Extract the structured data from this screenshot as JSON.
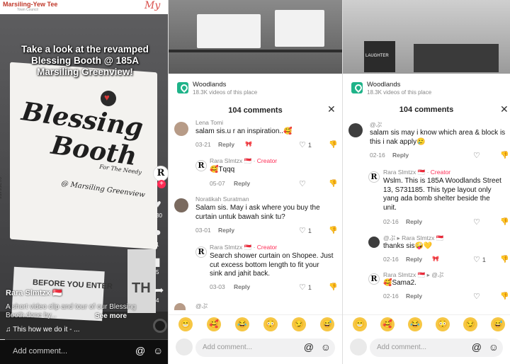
{
  "video": {
    "brand": "Marsiling-Yew Tee",
    "brand_sub": "Town Council",
    "brand_mark": "My",
    "title": "Take a look at the revamped Blessing Booth @ 185A Marsiling Greenview!",
    "sign_line1": "Blessing",
    "sign_line2": "Booth",
    "sign_tagline": "For The Needy",
    "sign_location": "@ Marsiling Greenview",
    "side_number": "91256456",
    "door_text": "BEFORE YOU ENTER",
    "th_text": "TH",
    "author": "Rara Slmtzx 🇸🇬",
    "description": "A short video clip and tour of our Blessing Booth done by...",
    "see_more": "See more",
    "music": "♫ This how we do it  - ...",
    "counts": [
      "30",
      "1",
      "5",
      "4"
    ],
    "progress": 0.03,
    "add_comment": "Add comment...",
    "at_icon": "@",
    "emoji_icon": "☺"
  },
  "comments_left": {
    "location_name": "Woodlands",
    "location_sub": "18.3K videos of this place",
    "title": "104 comments",
    "close": "✕",
    "items": [
      {
        "name": "Lena Tomi",
        "text": "salam sis.u r an inspiration..🥰",
        "date": "03-21",
        "reply": "Reply",
        "likes": "1",
        "flag": "🎀"
      },
      {
        "name": "Rara Slmtzx 🇸🇬 · ",
        "creator": "Creator",
        "text": "🥰Tqqq",
        "date": "05-07",
        "reply": "Reply",
        "likes": ""
      },
      {
        "name": "Noratikah Suratman",
        "text": "Salam sis. May i ask where you buy the curtain untuk bawah sink tu?",
        "date": "03-01",
        "reply": "Reply",
        "likes": "1"
      },
      {
        "name": "Rara Slmtzx 🇸🇬 · ",
        "creator": "Creator",
        "text": "Search shower curtain on Shopee. Just cut excess bottom length to fit your sink and jahit back.",
        "date": "03-03",
        "reply": "Reply",
        "likes": "1"
      },
      {
        "name": "@ぷ"
      }
    ],
    "emojis": [
      "😁",
      "🥰",
      "😂",
      "😳",
      "😏",
      "😅"
    ],
    "placeholder": "Add comment...",
    "at_icon": "@",
    "emoji_icon": "☺"
  },
  "comments_right": {
    "location_name": "Woodlands",
    "location_sub": "18.3K videos of this place",
    "title": "104 comments",
    "close": "✕",
    "items": [
      {
        "name": "@ぷ",
        "text": "salam sis may i know which area & block is this i nak apply🥲",
        "date": "02-16",
        "reply": "Reply",
        "likes": ""
      },
      {
        "name": "Rara Slmtzx 🇸🇬 · ",
        "creator": "Creator",
        "text": "Wslm. This is 185A Woodlands Street 13, S731185. This type layout only yang ada bomb shelter beside the unit.",
        "date": "02-16",
        "reply": "Reply",
        "likes": ""
      },
      {
        "name": "@ぷ ▸ Rara Slmtzx 🇸🇬",
        "text": "thanks sis🤪💛",
        "date": "02-16",
        "reply": "Reply",
        "likes": "1",
        "flag": "🎀"
      },
      {
        "name": "Rara Slmtzx 🇸🇬 ▸ @ぷ",
        "text": "🥰Sama2.",
        "date": "02-16",
        "reply": "Reply",
        "likes": ""
      }
    ],
    "emojis": [
      "😁",
      "🥰",
      "😂",
      "😳",
      "😏",
      "😅"
    ],
    "placeholder": "Add comment...",
    "at_icon": "@",
    "emoji_icon": "☺"
  },
  "shelf_sign": "LAUGHTER"
}
